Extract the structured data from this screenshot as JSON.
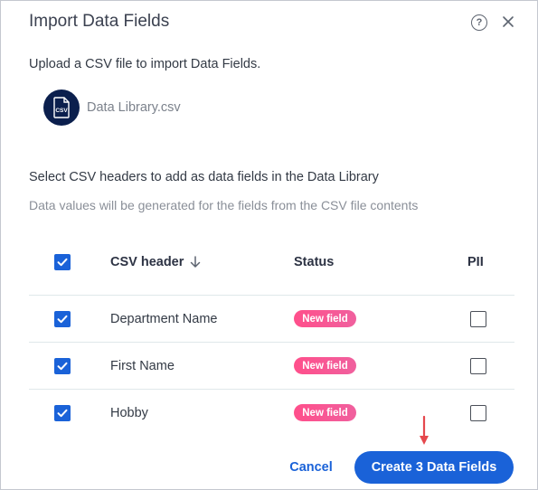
{
  "dialog": {
    "title": "Import Data Fields",
    "upload_text": "Upload a CSV file to import Data Fields.",
    "file_name": "Data Library.csv",
    "file_icon_label": "CSV",
    "select_text": "Select CSV headers to add as data fields in the Data Library",
    "hint_text": "Data values will be generated for the fields from the CSV file contents"
  },
  "table": {
    "headers": {
      "csv_header": "CSV header",
      "status": "Status",
      "pii": "PII"
    },
    "select_all_checked": true,
    "rows": [
      {
        "name": "Department Name",
        "status": "New field",
        "selected": true,
        "pii": false
      },
      {
        "name": "First Name",
        "status": "New field",
        "selected": true,
        "pii": false
      },
      {
        "name": "Hobby",
        "status": "New field",
        "selected": true,
        "pii": false
      }
    ]
  },
  "actions": {
    "cancel_label": "Cancel",
    "create_label": "Create 3 Data Fields"
  },
  "icons": {
    "help": "help-circle-icon",
    "close": "close-icon",
    "file": "csv-file-icon",
    "sort": "arrow-down-icon",
    "annotation": "red-arrow-down-icon"
  },
  "colors": {
    "primary": "#1a62d8",
    "badge": "#ff4f8b",
    "file_badge_bg": "#0b1f4d",
    "annotation_arrow": "#e5484d"
  }
}
